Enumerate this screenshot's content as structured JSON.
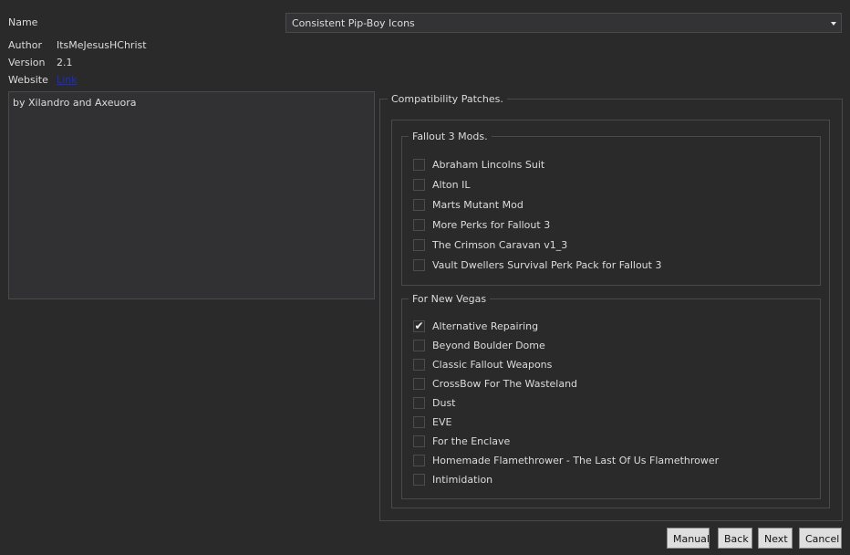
{
  "info": {
    "name_label": "Name",
    "author_label": "Author",
    "author_value": "ItsMeJesusHChrist",
    "version_label": "Version",
    "version_value": "2.1",
    "website_label": "Website",
    "website_link": "Link"
  },
  "name_select": {
    "selected": "Consistent Pip-Boy Icons"
  },
  "description": "by Xilandro and Axeuora",
  "compat": {
    "title": "Compatibility Patches.",
    "groups": [
      {
        "title": "Fallout 3 Mods.",
        "items": [
          {
            "label": "Abraham Lincolns Suit",
            "checked": false
          },
          {
            "label": "Alton IL",
            "checked": false
          },
          {
            "label": "Marts Mutant Mod",
            "checked": false
          },
          {
            "label": "More Perks for Fallout 3",
            "checked": false
          },
          {
            "label": "The Crimson Caravan v1_3",
            "checked": false
          },
          {
            "label": "Vault Dwellers Survival Perk Pack for Fallout 3",
            "checked": false
          }
        ]
      },
      {
        "title": "For New Vegas",
        "items": [
          {
            "label": "Alternative Repairing",
            "checked": true
          },
          {
            "label": "Beyond Boulder Dome",
            "checked": false
          },
          {
            "label": "Classic Fallout Weapons",
            "checked": false
          },
          {
            "label": "CrossBow For The Wasteland",
            "checked": false
          },
          {
            "label": "Dust",
            "checked": false
          },
          {
            "label": "EVE",
            "checked": false
          },
          {
            "label": "For the Enclave",
            "checked": false
          },
          {
            "label": "Homemade Flamethrower - The Last Of Us Flamethrower",
            "checked": false
          },
          {
            "label": "Intimidation",
            "checked": false
          }
        ]
      }
    ]
  },
  "buttons": {
    "manual": "Manual",
    "back": "Back",
    "next": "Next",
    "cancel": "Cancel"
  },
  "colors": {
    "background": "#2a2a2b",
    "border": "#4a4a4c",
    "text": "#dcdcdc",
    "link": "#1a2bd6"
  }
}
